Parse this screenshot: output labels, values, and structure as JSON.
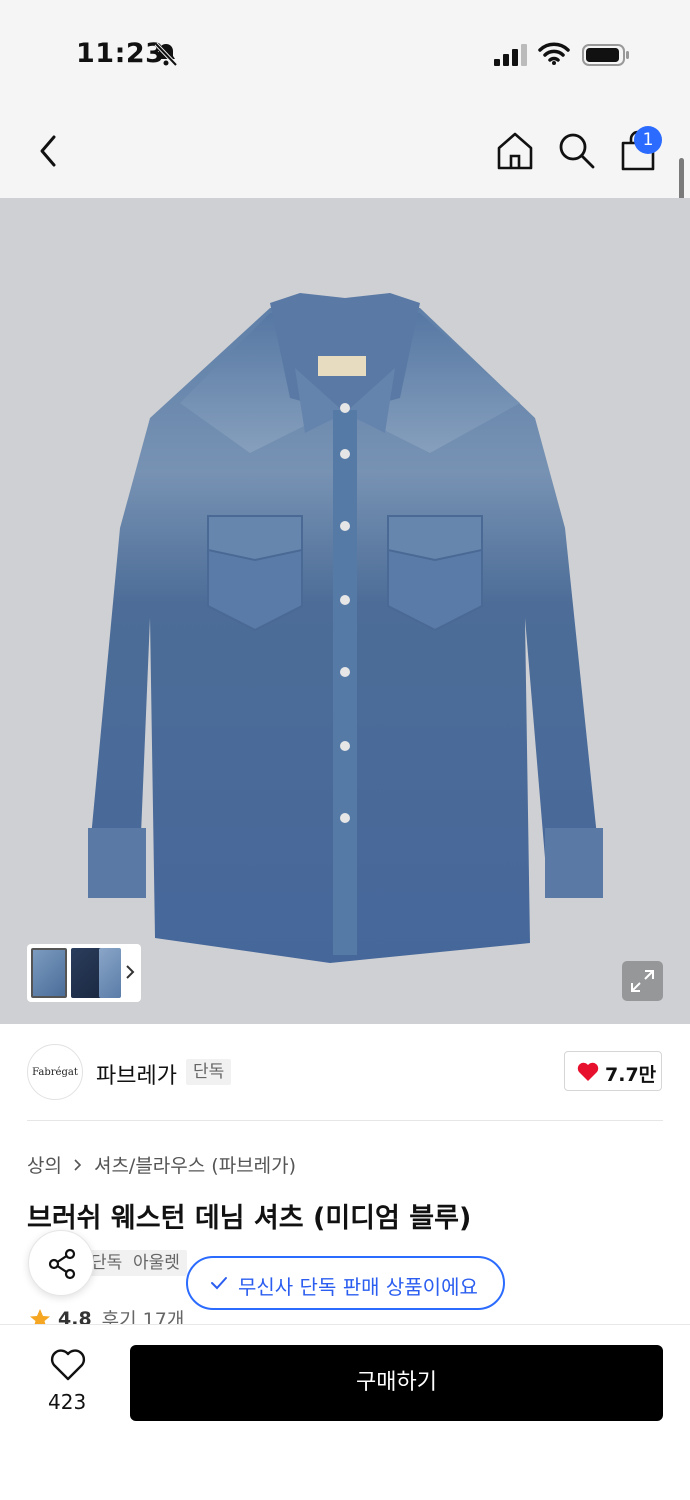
{
  "status_bar": {
    "time": "11:23",
    "icons": [
      "bell-off-icon",
      "signal-icon",
      "wifi-icon",
      "battery-icon"
    ]
  },
  "nav": {
    "icons": [
      "back-icon",
      "home-icon",
      "search-icon",
      "cart-icon"
    ],
    "cart_badge": "1"
  },
  "product_image": {
    "thumbnail_count": 3,
    "icons": [
      "chevron-right-icon",
      "expand-icon"
    ]
  },
  "brand": {
    "logo_text": "Fabrégat",
    "name": "파브레가",
    "tag": "단독",
    "likes": "7.7만"
  },
  "breadcrumb": {
    "category": "상의",
    "subcategory": "셔츠/블라우스 (파브레가)"
  },
  "product": {
    "title": "브러쉬 웨스턴 데님 셔츠 (미디엄 블루)",
    "tags": [
      "단독",
      "아울렛"
    ],
    "exclusive_notice": "무신사 단독 판매 상품이에요",
    "rating": "4.8",
    "reviews": "후기 17개"
  },
  "bottom_bar": {
    "like_count": "423",
    "buy_label": "구매하기"
  },
  "colors": {
    "accent": "#2b6bff",
    "heart": "#e8112d",
    "star": "#f5a623",
    "buy_bg": "#000000"
  }
}
